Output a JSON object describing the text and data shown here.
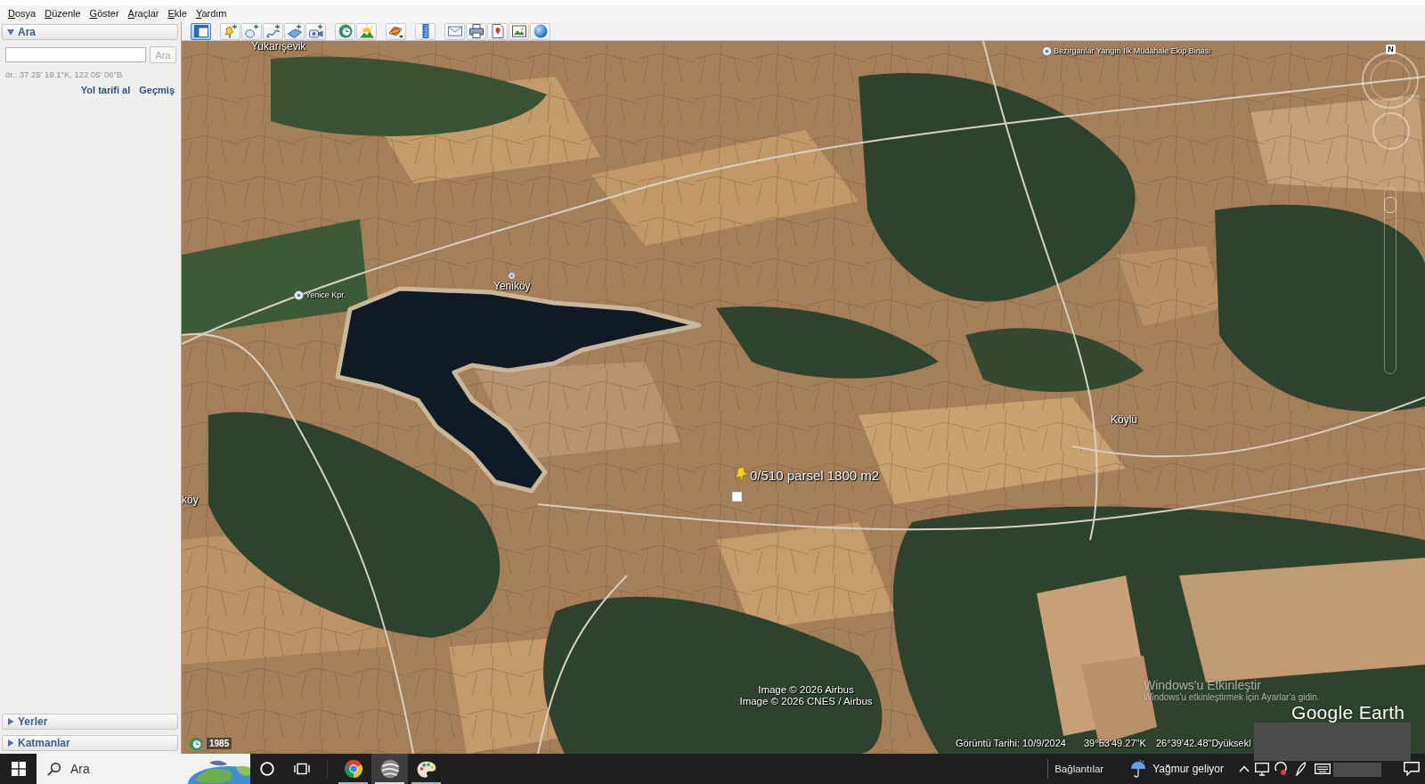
{
  "menu_bar": {
    "items": [
      "Dosya",
      "Düzenle",
      "Göster",
      "Araçlar",
      "Ekle",
      "Yardım"
    ]
  },
  "sidebar": {
    "search_panel": {
      "title": "Ara",
      "expanded": true,
      "search_button": {
        "label": "Ara",
        "disabled": true
      },
      "example": "ör.: 37 25' 19.1\"K, 122 05' 06\"B",
      "links": [
        "Yol tarifi al",
        "Geçmiş"
      ]
    },
    "panels": [
      {
        "title": "Yerler",
        "expanded": false
      },
      {
        "title": "Katmanlar",
        "expanded": false
      }
    ]
  },
  "toolbar": {
    "groups": [
      [
        {
          "kind": "sidebar",
          "selected": true
        }
      ],
      [
        {
          "kind": "placemark",
          "selected": false
        },
        {
          "kind": "polygon",
          "selected": false
        },
        {
          "kind": "path",
          "selected": false
        },
        {
          "kind": "image-overlay",
          "selected": false
        },
        {
          "kind": "tour",
          "selected": false
        }
      ],
      [
        {
          "kind": "history",
          "selected": false
        },
        {
          "kind": "sun",
          "selected": false
        }
      ],
      [
        {
          "kind": "planet",
          "selected": false
        }
      ],
      [
        {
          "kind": "ruler",
          "selected": false
        }
      ],
      [
        {
          "kind": "email",
          "selected": false
        },
        {
          "kind": "print",
          "selected": false
        },
        {
          "kind": "maps",
          "selected": false
        },
        {
          "kind": "save-image",
          "selected": false
        },
        {
          "kind": "earth",
          "selected": false
        }
      ]
    ]
  },
  "map": {
    "places": [
      {
        "name": "Yukarışevik",
        "kind": "label"
      },
      {
        "name": "Bezirganlar Yangın İlk Müdahale Ekip Binası",
        "kind": "poi"
      },
      {
        "name": "Yenice Kpr.",
        "kind": "poi"
      },
      {
        "name": "Yeniköy",
        "kind": "village"
      },
      {
        "name": "Köylü",
        "kind": "label"
      },
      {
        "name": "köy",
        "kind": "label"
      }
    ],
    "placemark": {
      "label": "0/510 parsel 1800 m2"
    },
    "compass_label": "N",
    "zoom_slider": {
      "level": 0.95
    },
    "attribution": [
      "Image © 2026 Airbus",
      "Image © 2026 CNES / Airbus"
    ],
    "os_notice": {
      "title": "Windows'u Etkinleştir",
      "text": "Windows'u etkinleştirmek için Ayarlar'a gidin."
    },
    "logo": "Google Earth"
  },
  "status_bar": {
    "history_year": "1985",
    "image_date": "Görüntü Tarihi: 10/9/2024",
    "latitude": "39°53'49.27\"K",
    "longitude": "26°39'42.48\"D",
    "elevation": "yüksekl"
  },
  "taskbar": {
    "search": {
      "placeholder": "Ara"
    },
    "apps": [
      {
        "kind": "chrome",
        "running": true,
        "selected": false
      },
      {
        "kind": "google-earth",
        "running": true,
        "selected": true
      },
      {
        "kind": "paint",
        "running": true,
        "selected": false
      }
    ],
    "toolbar_label": "Bağlantılar",
    "weather": "Yağmur geliyor"
  }
}
